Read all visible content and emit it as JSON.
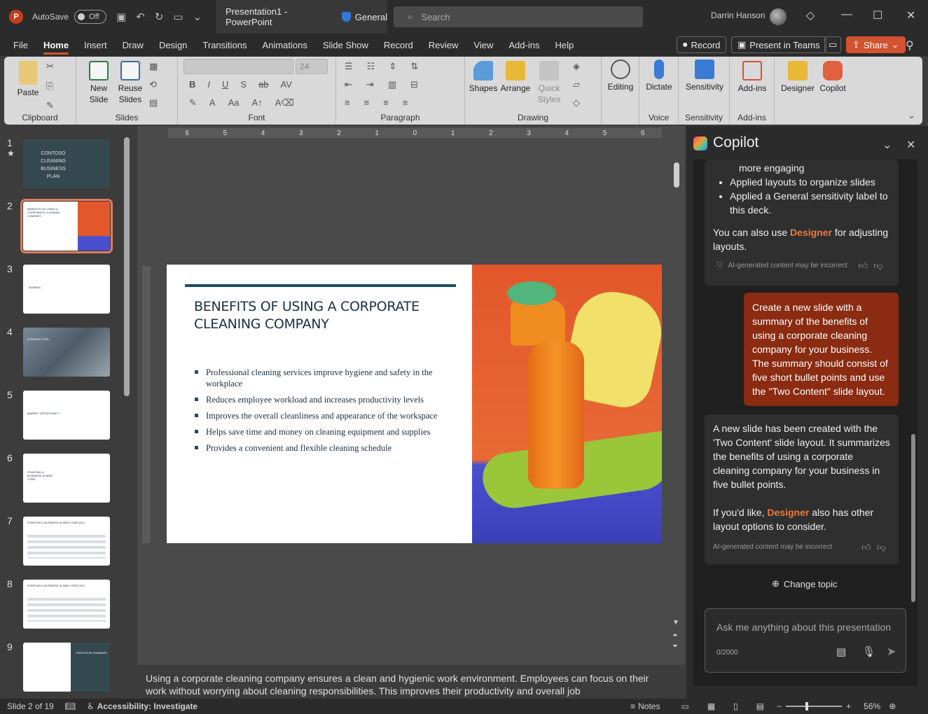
{
  "titlebar": {
    "autosave_label": "AutoSave",
    "autosave_state": "Off",
    "doc_title": "Presentation1 - PowerPoint",
    "sensitivity": "General",
    "search_placeholder": "Search",
    "user_name": "Darrin Hanson"
  },
  "tabs": [
    "File",
    "Home",
    "Insert",
    "Draw",
    "Design",
    "Transitions",
    "Animations",
    "Slide Show",
    "Record",
    "Review",
    "View",
    "Add-ins",
    "Help"
  ],
  "tab_actions": {
    "record": "Record",
    "present_teams": "Present in Teams",
    "share": "Share"
  },
  "ribbon": {
    "paste": "Paste",
    "clipboard": "Clipboard",
    "new_slide": "New Slide",
    "reuse_slides": "Reuse Slides",
    "slides": "Slides",
    "font_size": "24",
    "font": "Font",
    "paragraph": "Paragraph",
    "shapes": "Shapes",
    "arrange": "Arrange",
    "quick_styles": "Quick Styles",
    "drawing": "Drawing",
    "editing": "Editing",
    "dictate": "Dictate",
    "voice": "Voice",
    "sensitivity": "Sensitivity",
    "sensitivity_group": "Sensitivity",
    "addins": "Add-ins",
    "addins_group": "Add-ins",
    "designer": "Designer",
    "copilot": "Copilot"
  },
  "thumbnails": [
    {
      "num": "1",
      "text": "CONTOSO CLEANING BUSINESS PLAN"
    },
    {
      "num": "2",
      "text": "BENEFITS OF USING A CORPORATE CLEANING COMPANY"
    },
    {
      "num": "3",
      "text": "AGENDA"
    },
    {
      "num": "4",
      "text": "INTRODUCTION"
    },
    {
      "num": "5",
      "text": "MARKET OPPORTUNITY"
    },
    {
      "num": "6",
      "text": "STARTING A BUSINESS IN NEW YORK"
    },
    {
      "num": "7",
      "text": "STARTING A BUSINESS IN NEW YORK (1/2)"
    },
    {
      "num": "8",
      "text": "STARTING A BUSINESS IN NEW YORK (2/2)"
    },
    {
      "num": "9",
      "text": "EXECUTIVE SUMMARY"
    }
  ],
  "ruler_h": [
    "6",
    "5",
    "4",
    "3",
    "2",
    "1",
    "0",
    "1",
    "2",
    "3",
    "4",
    "5",
    "6"
  ],
  "slide": {
    "title": "BENEFITS OF USING A CORPORATE CLEANING COMPANY",
    "bullets": [
      "Professional cleaning services improve hygiene and safety in the workplace",
      "Reduces employee workload and increases productivity levels",
      "Improves the overall cleanliness and appearance of the workspace",
      "Helps save time and money on cleaning equipment and supplies",
      "Provides a convenient and flexible cleaning schedule"
    ]
  },
  "notes": "Using a corporate cleaning company ensures a clean and hygienic work environment. Employees can focus on their work without worrying about cleaning responsibilities. This improves their productivity and overall job",
  "copilot": {
    "title": "Copilot",
    "msg1_partial": "more engaging",
    "msg1_bullets": [
      "Applied layouts to organize slides",
      "Applied a General sensitivity label to this deck."
    ],
    "msg1_tail_a": "You can also use ",
    "msg1_designer": "Designer",
    "msg1_tail_b": " for adjusting layouts.",
    "ai_note": "AI-generated content may be incorrect",
    "user_prompt": "Create a new slide with a summary of the benefits of using a corporate cleaning company for your business. The summary should consist of five short bullet points and use the \"Two Content\" slide layout.",
    "msg2_text": "A new slide has been created with the 'Two Content' slide layout. It summarizes the benefits of using a corporate cleaning company for your business in five bullet points.",
    "msg2_tail_a": "If you'd like, ",
    "msg2_designer": "Designer",
    "msg2_tail_b": " also has other layout options to consider.",
    "change_topic": "Change topic",
    "ask_placeholder": "Ask me anything about this presentation",
    "char_count": "0/2000"
  },
  "status": {
    "slide_counter": "Slide 2 of 19",
    "accessibility": "Accessibility: Investigate",
    "notes": "Notes",
    "zoom": "56%"
  },
  "colors": {
    "accent": "#d35230",
    "slide_title": "#1a2f44",
    "bar": "#1f4e5f",
    "user_bubble": "#8a2b12"
  }
}
